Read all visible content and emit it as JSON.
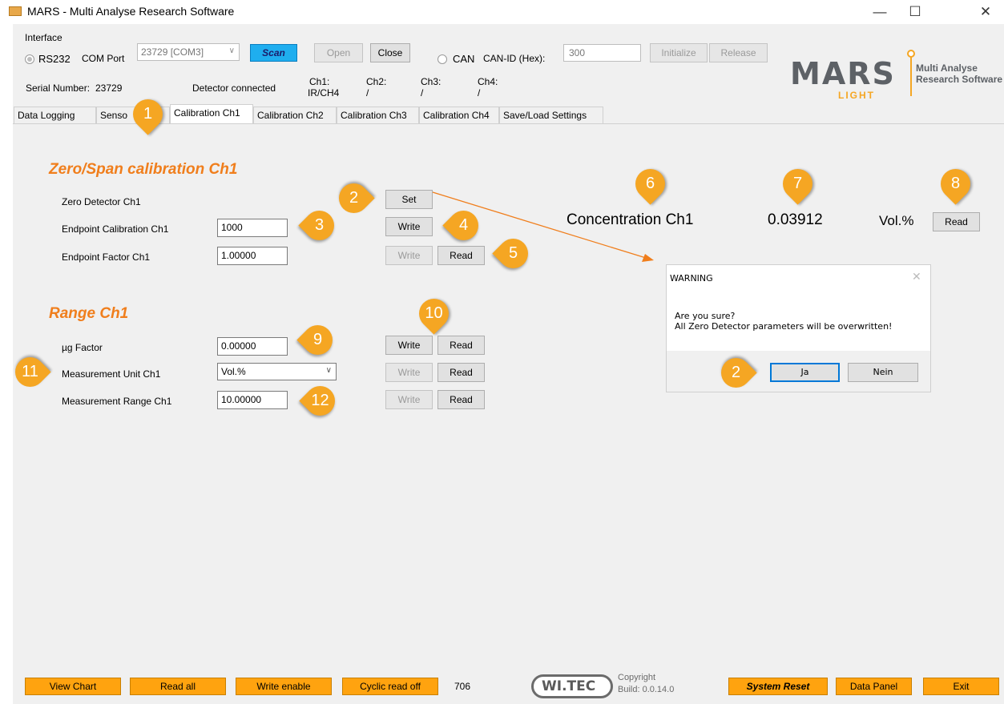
{
  "window": {
    "title": "MARS - Multi Analyse Research Software",
    "minimize": "—",
    "maximize": "☐",
    "close": "✕"
  },
  "interface": {
    "label": "Interface",
    "rs232": "RS232",
    "com_port_label": "COM Port",
    "com_port_value": "23729 [COM3]",
    "scan": "Scan",
    "open": "Open",
    "close": "Close",
    "can": "CAN",
    "can_id_label": "CAN-ID (Hex):",
    "can_id_value": "300",
    "initialize": "Initialize",
    "release": "Release"
  },
  "status": {
    "serial_label": "Serial Number:",
    "serial_value": "23729",
    "detector": "Detector connected",
    "ch1_label": "Ch1:",
    "ch1_value": "IR/CH4",
    "ch2_label": "Ch2:",
    "ch2_value": "/",
    "ch3_label": "Ch3:",
    "ch3_value": "/",
    "ch4_label": "Ch4:",
    "ch4_value": "/"
  },
  "logo": {
    "mars": "MARS",
    "light": "LIGHT",
    "line1": "Multi Analyse",
    "line2": "Research Software"
  },
  "tabs": [
    "Data Logging",
    "Senso",
    "Calibration Ch1",
    "Calibration Ch2",
    "Calibration Ch3",
    "Calibration Ch4",
    "Save/Load Settings"
  ],
  "zero_span": {
    "title": "Zero/Span calibration Ch1",
    "zero_label": "Zero Detector Ch1",
    "set": "Set",
    "endpoint_label": "Endpoint Calibration Ch1",
    "endpoint_value": "1000",
    "write": "Write",
    "factor_label": "Endpoint Factor Ch1",
    "factor_value": "1.00000",
    "read": "Read"
  },
  "concentration": {
    "label": "Concentration Ch1",
    "value": "0.03912",
    "unit": "Vol.%",
    "read": "Read"
  },
  "range": {
    "title": "Range Ch1",
    "ug_label": "µg Factor",
    "ug_value": "0.00000",
    "unit_label": "Measurement Unit Ch1",
    "unit_value": "Vol.%",
    "mrange_label": "Measurement Range Ch1",
    "mrange_value": "10.00000",
    "write": "Write",
    "read": "Read"
  },
  "dialog": {
    "title": "WARNING",
    "line1": "Are you sure?",
    "line2": "All Zero Detector parameters will be overwritten!",
    "yes": "Ja",
    "no": "Nein"
  },
  "footer": {
    "view_chart": "View Chart",
    "read_all": "Read all",
    "write_enable": "Write enable",
    "cyclic": "Cyclic read off",
    "counter": "706",
    "witec": "WI.TEC",
    "copyright": "Copyright",
    "build": "Build: 0.0.14.0",
    "system_reset": "System Reset",
    "data_panel": "Data Panel",
    "exit": "Exit"
  },
  "callouts": [
    "1",
    "2",
    "3",
    "4",
    "5",
    "6",
    "7",
    "8",
    "9",
    "10",
    "11",
    "12",
    "2"
  ],
  "colors": {
    "accent": "#f07e1c",
    "callout": "#f5a623",
    "footer_button": "#ffa30f",
    "scan": "#1faeef",
    "dialog_default": "#0078d7"
  }
}
